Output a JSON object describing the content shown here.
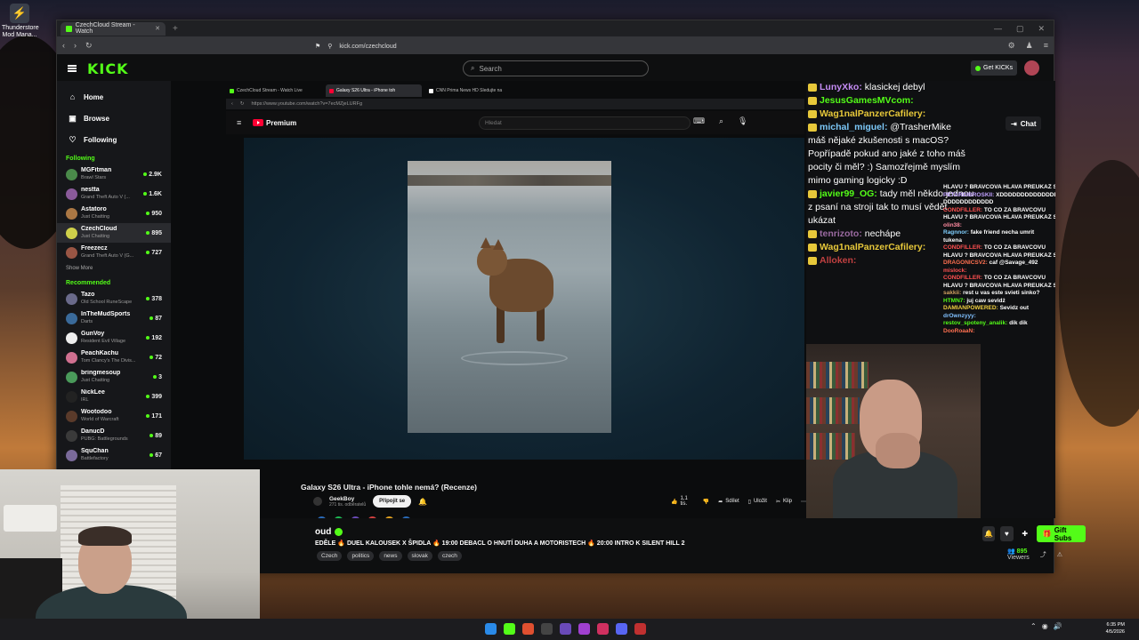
{
  "desktop": {
    "icon_label": "Thunderstore Mod Mana..."
  },
  "browser": {
    "tab_title": "CzechCloud Stream - Watch",
    "url": "kick.com/czechcloud"
  },
  "kick": {
    "search_placeholder": "Search",
    "get_kicks": "Get KICKs",
    "nav": [
      {
        "label": "Home",
        "icon": "home-icon",
        "glyph": "⌂"
      },
      {
        "label": "Browse",
        "icon": "browse-icon",
        "glyph": "▣"
      },
      {
        "label": "Following",
        "icon": "heart-icon",
        "glyph": "♡"
      }
    ],
    "following_title": "Following",
    "following": [
      {
        "name": "MGFitman",
        "game": "Brawl Stars",
        "viewers": "2.9K",
        "color": "#4a8a4a"
      },
      {
        "name": "nestta",
        "game": "Grand Theft Auto V (...",
        "viewers": "1.6K",
        "color": "#8a5a9a"
      },
      {
        "name": "Astatoro",
        "game": "Just Chatting",
        "viewers": "950",
        "color": "#aa7744"
      },
      {
        "name": "CzechCloud",
        "game": "Just Chatting",
        "viewers": "895",
        "color": "#cfd04a"
      },
      {
        "name": "Freezecz",
        "game": "Grand Theft Auto V (G...",
        "viewers": "727",
        "color": "#995544"
      }
    ],
    "show_more": "Show More",
    "recommended_title": "Recommended",
    "recommended": [
      {
        "name": "Tazo",
        "game": "Old School RuneScape",
        "viewers": "378",
        "color": "#6a6a8a"
      },
      {
        "name": "InTheMudSports",
        "game": "Darts",
        "viewers": "87",
        "color": "#3a6a9a"
      },
      {
        "name": "GunVoy",
        "game": "Resident Evil Village",
        "viewers": "192",
        "color": "#eeeeee"
      },
      {
        "name": "PeachKachu",
        "game": "Tom Clancy's The Divis...",
        "viewers": "72",
        "color": "#d07090"
      },
      {
        "name": "bringmesoup",
        "game": "Just Chatting",
        "viewers": "3",
        "color": "#4a9a5a"
      },
      {
        "name": "NickLee",
        "game": "IRL",
        "viewers": "399",
        "color": "#222222"
      },
      {
        "name": "Wootodoo",
        "game": "World of Warcraft",
        "viewers": "171",
        "color": "#5a3a2a"
      },
      {
        "name": "DanucD",
        "game": "PUBG: Battlegrounds",
        "viewers": "89",
        "color": "#3a3a3a"
      },
      {
        "name": "SquChan",
        "game": "Battlefactory",
        "viewers": "67",
        "color": "#7a6a9a"
      }
    ]
  },
  "stream": {
    "inner_tabs": [
      "CzechCloud Stream - Watch Live",
      "Galaxy S26 Ultra - iPhone toh",
      "CNN Prima News HD Sledujte na"
    ],
    "inner_url": "https://www.youtube.com/watch?v=7ecMZjeLURFg",
    "yt_brand": "Premium",
    "yt_search": "Hledat",
    "video_title": "Galaxy S26 Ultra - iPhone tohle nemá? (Recenze)",
    "channel": "GeekBoy",
    "subs": "271 tis. odběratelů",
    "join": "Připojit se",
    "likes": "1,1 tis.",
    "share": "Sdílet",
    "save": "Uložit",
    "clip": "Klip"
  },
  "chat": {
    "button": "Chat",
    "lines": [
      {
        "user": "LunyXko:",
        "msg": "klasickej debyl",
        "color": "#c58cf5"
      },
      {
        "user": "JesusGamesMVcom:",
        "msg": "",
        "color": "#53fc18"
      },
      {
        "user": "Wag1nalPanzerCafilery:",
        "msg": "",
        "color": "#e7c83a"
      },
      {
        "user": "michal_miguel:",
        "msg": "@TrasherMike",
        "color": "#7cc8f8"
      },
      {
        "user": "",
        "msg": "máš nějaké zkušenosti s macOS?",
        "color": "#fff"
      },
      {
        "user": "",
        "msg": "Popřípadě pokud ano jaké z toho máš",
        "color": "#fff"
      },
      {
        "user": "",
        "msg": "pocity či měl? :) Samozřejmě myslím",
        "color": "#fff"
      },
      {
        "user": "",
        "msg": "mimo gaming logicky :D",
        "color": "#fff"
      },
      {
        "user": "javier99_OG:",
        "msg": "tady měl někdo jednou",
        "color": "#53fc18"
      },
      {
        "user": "",
        "msg": "z psaní na stroji tak to musí vědět",
        "color": "#fff"
      },
      {
        "user": "",
        "msg": "ukázat",
        "color": "#fff"
      },
      {
        "user": "tenrizoto:",
        "msg": "nechápe",
        "color": "#9a6aa0"
      },
      {
        "user": "Wag1nalPanzerCafilery:",
        "msg": "",
        "color": "#e7c83a"
      },
      {
        "user": "Alloken:",
        "msg": "",
        "color": "#c04040"
      }
    ],
    "right_lines": [
      {
        "user": "",
        "msg": "HLAVU ? BRAVČOVA HLAVA PREUKAŽ SA",
        "color": "#fff"
      },
      {
        "user": "PETARDIBROSKII:",
        "msg": "XDDDDDDDDDDDDDDD",
        "color": "#c0a0ff"
      },
      {
        "user": "",
        "msg": "DDDDDDDDDDDD",
        "color": "#fff"
      },
      {
        "user": "CONDFILLER:",
        "msg": "TO ČO ZA BRAVČOVU",
        "color": "#ff5050"
      },
      {
        "user": "",
        "msg": "HLAVU ? BRAVČOVA HLAVA PREUKAŽ SA",
        "color": "#fff"
      },
      {
        "user": "olin38:",
        "msg": "",
        "color": "#ff8aa0"
      },
      {
        "user": "Ragnnor:",
        "msg": "fake friend necha umrit",
        "color": "#80d0ff"
      },
      {
        "user": "",
        "msg": "tukena",
        "color": "#fff"
      },
      {
        "user": "CONDFILLER:",
        "msg": "TO ČO ZA BRAVČOVU",
        "color": "#ff5050"
      },
      {
        "user": "",
        "msg": "HLAVU ? BRAVČOVA HLAVA PREUKAŽ SA",
        "color": "#fff"
      },
      {
        "user": "DRAGONICSV2:",
        "msg": "caf @Savage_492",
        "color": "#ff7050"
      },
      {
        "user": "mislock:",
        "msg": "",
        "color": "#ff5050"
      },
      {
        "user": "CONDFILLER:",
        "msg": "TO ČO ZA BRAVČOVU",
        "color": "#ff5050"
      },
      {
        "user": "",
        "msg": "HLAVU ? BRAVČOVA HLAVA PREUKAŽ SA",
        "color": "#fff"
      },
      {
        "user": "sakkii:",
        "msg": "rest u vas este svieti sinko?",
        "color": "#d0a060"
      },
      {
        "user": "HTMN7:",
        "msg": "juj caw sevidż",
        "color": "#53fc18"
      },
      {
        "user": "DAMIANPOWERED:",
        "msg": "Sevidz out",
        "color": "#f0d040"
      },
      {
        "user": "drOwnzyyy:",
        "msg": "",
        "color": "#80c0ff"
      },
      {
        "user": "restov_spoteny_analik:",
        "msg": "dik dik",
        "color": "#53fc18"
      },
      {
        "user": "DooRoaaN:",
        "msg": "",
        "color": "#ff7050"
      }
    ]
  },
  "below": {
    "channel_name": "oud",
    "title": "EDĚLE 🔥 DUEL KALOUSEK X ŠPIDLA 🔥 19:00 DEBACL O HNUTÍ DUHA A MOTORISTECH 🔥 20:00 INTRO K SILENT HILL 2",
    "tags": [
      "Czech",
      "politics",
      "news",
      "slovak",
      "czech"
    ],
    "gift": "Gift Subs",
    "viewers": "895",
    "viewers_label": "Viewers"
  },
  "taskbar": {
    "time": "6:35 PM",
    "date": "4/5/2026"
  }
}
